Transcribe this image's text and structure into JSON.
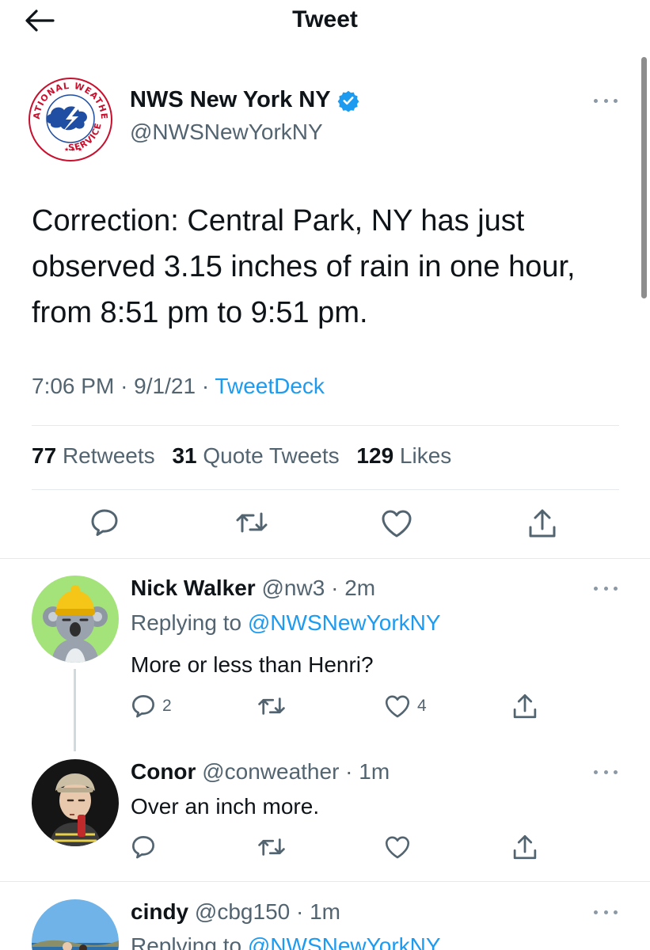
{
  "header": {
    "title": "Tweet",
    "back_icon": "back-arrow-icon"
  },
  "tweet": {
    "author": {
      "name": "NWS New York NY",
      "handle": "@NWSNewYorkNY",
      "verified": true,
      "logo_text": "NATIONAL WEATHER SERVICE"
    },
    "text": "Correction: Central Park, NY has just observed 3.15 inches of rain in one hour, from 8:51 pm to 9:51 pm.",
    "time": "7:06 PM",
    "date": "9/1/21",
    "client": "TweetDeck",
    "sep": "·",
    "stats": {
      "retweets": "77",
      "retweets_label": "Retweets",
      "quotes": "31",
      "quotes_label": "Quote Tweets",
      "likes": "129",
      "likes_label": "Likes"
    }
  },
  "replies": [
    {
      "name": "Nick Walker",
      "handle": "@nw3",
      "time": "2m",
      "replying_label": "Replying to",
      "replying_to": "@NWSNewYorkNY",
      "text": "More or less than Henri?",
      "reply_count": "2",
      "retweet_count": "",
      "like_count": "4"
    },
    {
      "name": "Conor",
      "handle": "@conweather",
      "time": "1m",
      "text": "Over an inch more.",
      "reply_count": "",
      "retweet_count": "",
      "like_count": ""
    },
    {
      "name": "cindy",
      "handle": "@cbg150",
      "time": "1m",
      "replying_label": "Replying to",
      "replying_to": "@NWSNewYorkNY"
    }
  ],
  "colors": {
    "link": "#1d9bf0",
    "secondary": "#536471",
    "primary": "#0f1419"
  }
}
